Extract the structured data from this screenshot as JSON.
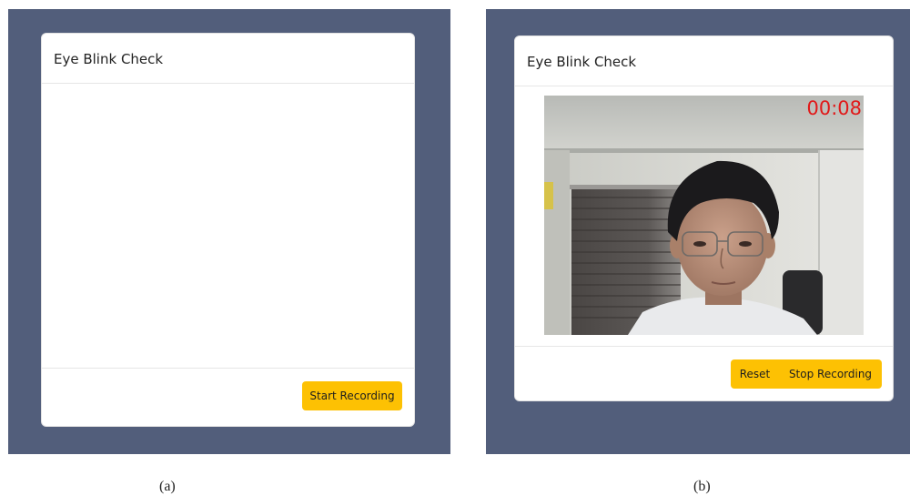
{
  "panel_a": {
    "card_title": "Eye Blink Check",
    "start_button_label": "Start Recording",
    "caption": "(a)"
  },
  "panel_b": {
    "card_title": "Eye Blink Check",
    "video_timer": "00:08",
    "reset_button_label": "Reset",
    "stop_button_label": "Stop Recording",
    "caption": "(b)"
  },
  "colors": {
    "backdrop": "#525e7b",
    "button": "#fdc103",
    "timer": "#e11919"
  }
}
